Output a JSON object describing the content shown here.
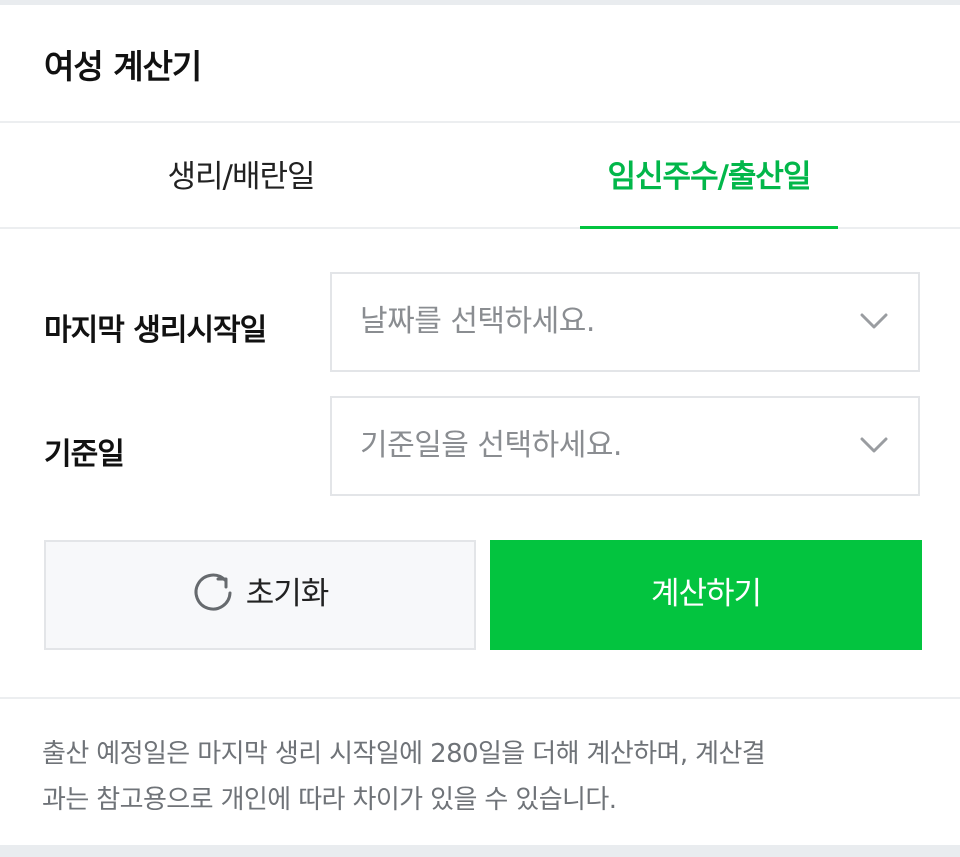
{
  "header": {
    "title": "여성 계산기"
  },
  "tabs": [
    {
      "label": "생리/배란일",
      "active": false
    },
    {
      "label": "임신주수/출산일",
      "active": true
    }
  ],
  "form": {
    "last_period": {
      "label": "마지막 생리시작일",
      "placeholder": "날짜를 선택하세요."
    },
    "reference_date": {
      "label": "기준일",
      "placeholder": "기준일을 선택하세요."
    }
  },
  "buttons": {
    "reset_label": "초기화",
    "calculate_label": "계산하기"
  },
  "note": {
    "line1": "출산 예정일은 마지막 생리 시작일에 280일을 더해 계산하며, 계산결",
    "line2": "과는 참고용으로 개인에 따라 차이가 있을 수 있습니다."
  },
  "colors": {
    "accent": "#03c43f",
    "accent_text": "#02b74a"
  },
  "icons": {
    "reset": "refresh-icon",
    "dropdown": "chevron-down-icon"
  }
}
